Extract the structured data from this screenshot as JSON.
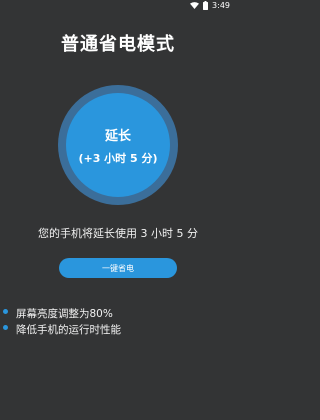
{
  "status_bar": {
    "time": "3:49",
    "icons": [
      "wifi-icon",
      "battery-icon"
    ]
  },
  "title": "普通省电模式",
  "circle": {
    "main_label": "延长",
    "sub_label": "(+3 小时 5 分)"
  },
  "info_text": "您的手机将延长使用 3 小时 5 分",
  "button": {
    "label": "一键省电"
  },
  "tips": [
    {
      "text": "屏幕亮度调整为80%"
    },
    {
      "text": "降低手机的运行时性能"
    }
  ],
  "colors": {
    "background": "#333435",
    "accent": "#2a96dd",
    "ring": "#3b6e9a"
  }
}
